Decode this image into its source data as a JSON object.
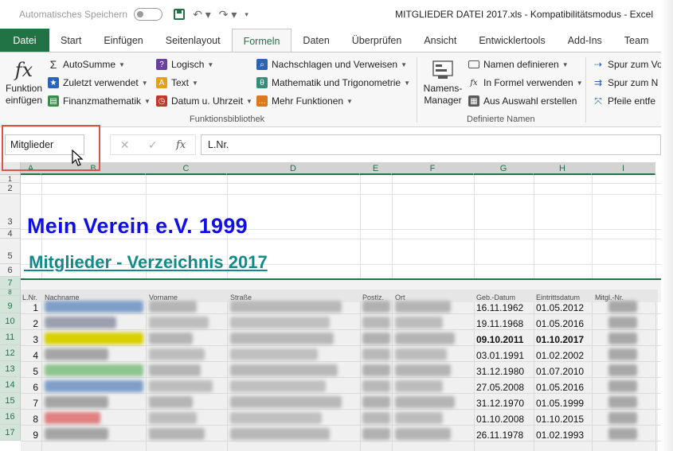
{
  "titlebar": {
    "autosave_label": "Automatisches Speichern",
    "document_title": "MITGLIEDER DATEI 2017.xls  -  Kompatibilitätsmodus  -  Excel"
  },
  "tabs": [
    "Datei",
    "Start",
    "Einfügen",
    "Seitenlayout",
    "Formeln",
    "Daten",
    "Überprüfen",
    "Ansicht",
    "Entwicklertools",
    "Add-Ins",
    "Team"
  ],
  "ribbon": {
    "insert_function": [
      "Funktion",
      "einfügen"
    ],
    "library_col1": [
      "AutoSumme",
      "Zuletzt verwendet",
      "Finanzmathematik"
    ],
    "library_col2": [
      "Logisch",
      "Text",
      "Datum u. Uhrzeit"
    ],
    "library_col3": [
      "Nachschlagen und Verweisen",
      "Mathematik und Trigonometrie",
      "Mehr Funktionen"
    ],
    "library_group_label": "Funktionsbibliothek",
    "name_manager": [
      "Namens-",
      "Manager"
    ],
    "names_col": [
      "Namen definieren",
      "In Formel verwenden",
      "Aus Auswahl erstellen"
    ],
    "names_group_label": "Definierte Namen",
    "audit_col": [
      "Spur zum Vo",
      "Spur zum N",
      "Pfeile entfe"
    ]
  },
  "formula_bar": {
    "name_box": "Mitglieder",
    "content": "L.Nr."
  },
  "grid": {
    "columns": [
      "A",
      "B",
      "C",
      "D",
      "E",
      "F",
      "G",
      "H",
      "I"
    ],
    "rows": [
      "1",
      "2",
      "3",
      "4",
      "5",
      "6",
      "7",
      "8",
      "9",
      "10",
      "11",
      "12",
      "13",
      "14",
      "15",
      "16",
      "17"
    ],
    "title1": "Mein Verein e.V. 1999",
    "title2": " Mitglieder - Verzeichnis 2017",
    "headers": [
      "L.Nr.",
      "Nachname",
      "Vorname",
      "Straße",
      "Postlz.",
      "Ort",
      "Geb.-Datum",
      "Eintrittsdatum",
      "Mitgl.-Nr."
    ],
    "records": [
      {
        "nr": "1",
        "geb": "16.11.1962",
        "ein": "01.05.2012"
      },
      {
        "nr": "2",
        "geb": "19.11.1968",
        "ein": "01.05.2016"
      },
      {
        "nr": "3",
        "geb": "09.10.2011",
        "ein": "01.10.2017"
      },
      {
        "nr": "4",
        "geb": "03.01.1991",
        "ein": "01.02.2002"
      },
      {
        "nr": "5",
        "geb": "31.12.1980",
        "ein": "01.07.2010"
      },
      {
        "nr": "6",
        "geb": "27.05.2008",
        "ein": "01.05.2016"
      },
      {
        "nr": "7",
        "geb": "31.12.1970",
        "ein": "01.05.1999"
      },
      {
        "nr": "8",
        "geb": "01.10.2008",
        "ein": "01.10.2015"
      },
      {
        "nr": "9",
        "geb": "26.11.1978",
        "ein": "01.02.1993"
      }
    ]
  },
  "colors": {
    "excel_green": "#217346",
    "title_blue": "#1010e6",
    "subtitle_teal": "#138a8a",
    "highlight_red": "#d9534f"
  }
}
